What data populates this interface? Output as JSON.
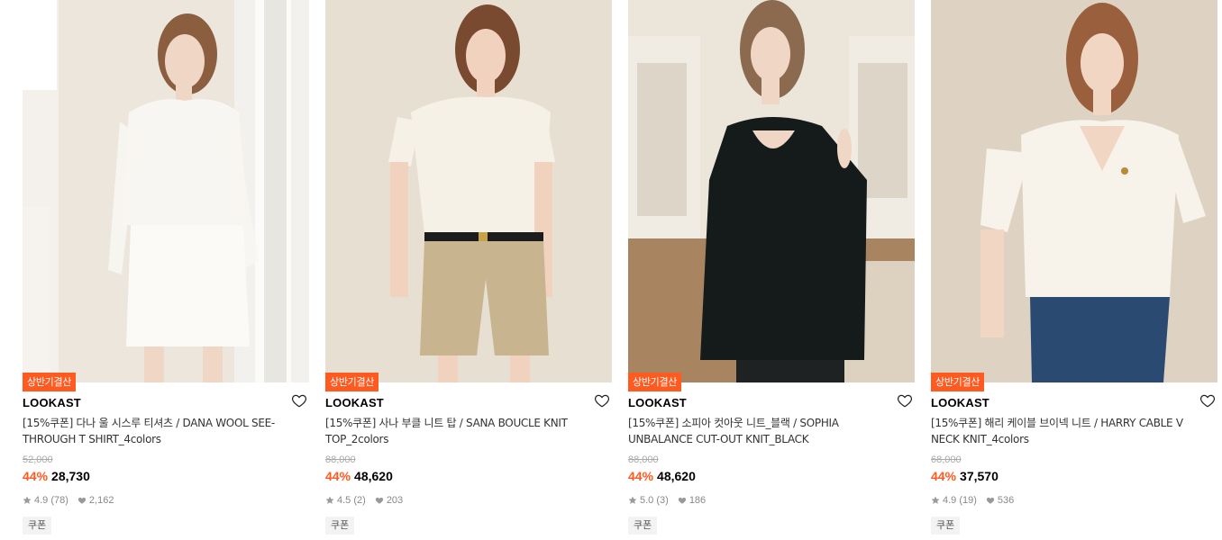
{
  "products": [
    {
      "badge": "상반기결산",
      "brand": "LOOKAST",
      "title": "[15%쿠폰] 다나 울 시스루 티셔츠 / DANA WOOL SEE-THROUGH T SHIRT_4colors",
      "original_price": "52,000",
      "discount": "44%",
      "price": "28,730",
      "rating": "4.9",
      "review_count": "(78)",
      "likes": "2,162",
      "tag": "쿠폰",
      "image": "model-sheer-white-top-white-skirt"
    },
    {
      "badge": "상반기결산",
      "brand": "LOOKAST",
      "title": "[15%쿠폰] 사나 부클 니트 탑 / SANA BOUCLE KNIT TOP_2colors",
      "original_price": "88,000",
      "discount": "44%",
      "price": "48,620",
      "rating": "4.5",
      "review_count": "(2)",
      "likes": "203",
      "tag": "쿠폰",
      "image": "model-cream-boucle-knit-beige-shorts"
    },
    {
      "badge": "상반기결산",
      "brand": "LOOKAST",
      "title": "[15%쿠폰] 소피아 컷아웃 니트_블랙 / SOPHIA UNBALANCE CUT-OUT KNIT_BLACK",
      "original_price": "88,000",
      "discount": "44%",
      "price": "48,620",
      "rating": "5.0",
      "review_count": "(3)",
      "likes": "186",
      "tag": "쿠폰",
      "image": "model-black-cutout-knit"
    },
    {
      "badge": "상반기결산",
      "brand": "LOOKAST",
      "title": "[15%쿠폰] 해리 케이블 브이넥 니트 / HARRY CABLE V NECK KNIT_4colors",
      "original_price": "68,000",
      "discount": "44%",
      "price": "37,570",
      "rating": "4.9",
      "review_count": "(19)",
      "likes": "536",
      "tag": "쿠폰",
      "image": "model-ivory-cable-vneck-knit-jeans"
    }
  ],
  "colors": {
    "accent": "#ff5a1f",
    "strike": "#aaaaaa",
    "meta": "#888888",
    "tag_bg": "#f3f3f3"
  },
  "icons": {
    "wish": "heart-outline-icon",
    "rating": "star-icon",
    "likes": "heart-filled-icon"
  }
}
